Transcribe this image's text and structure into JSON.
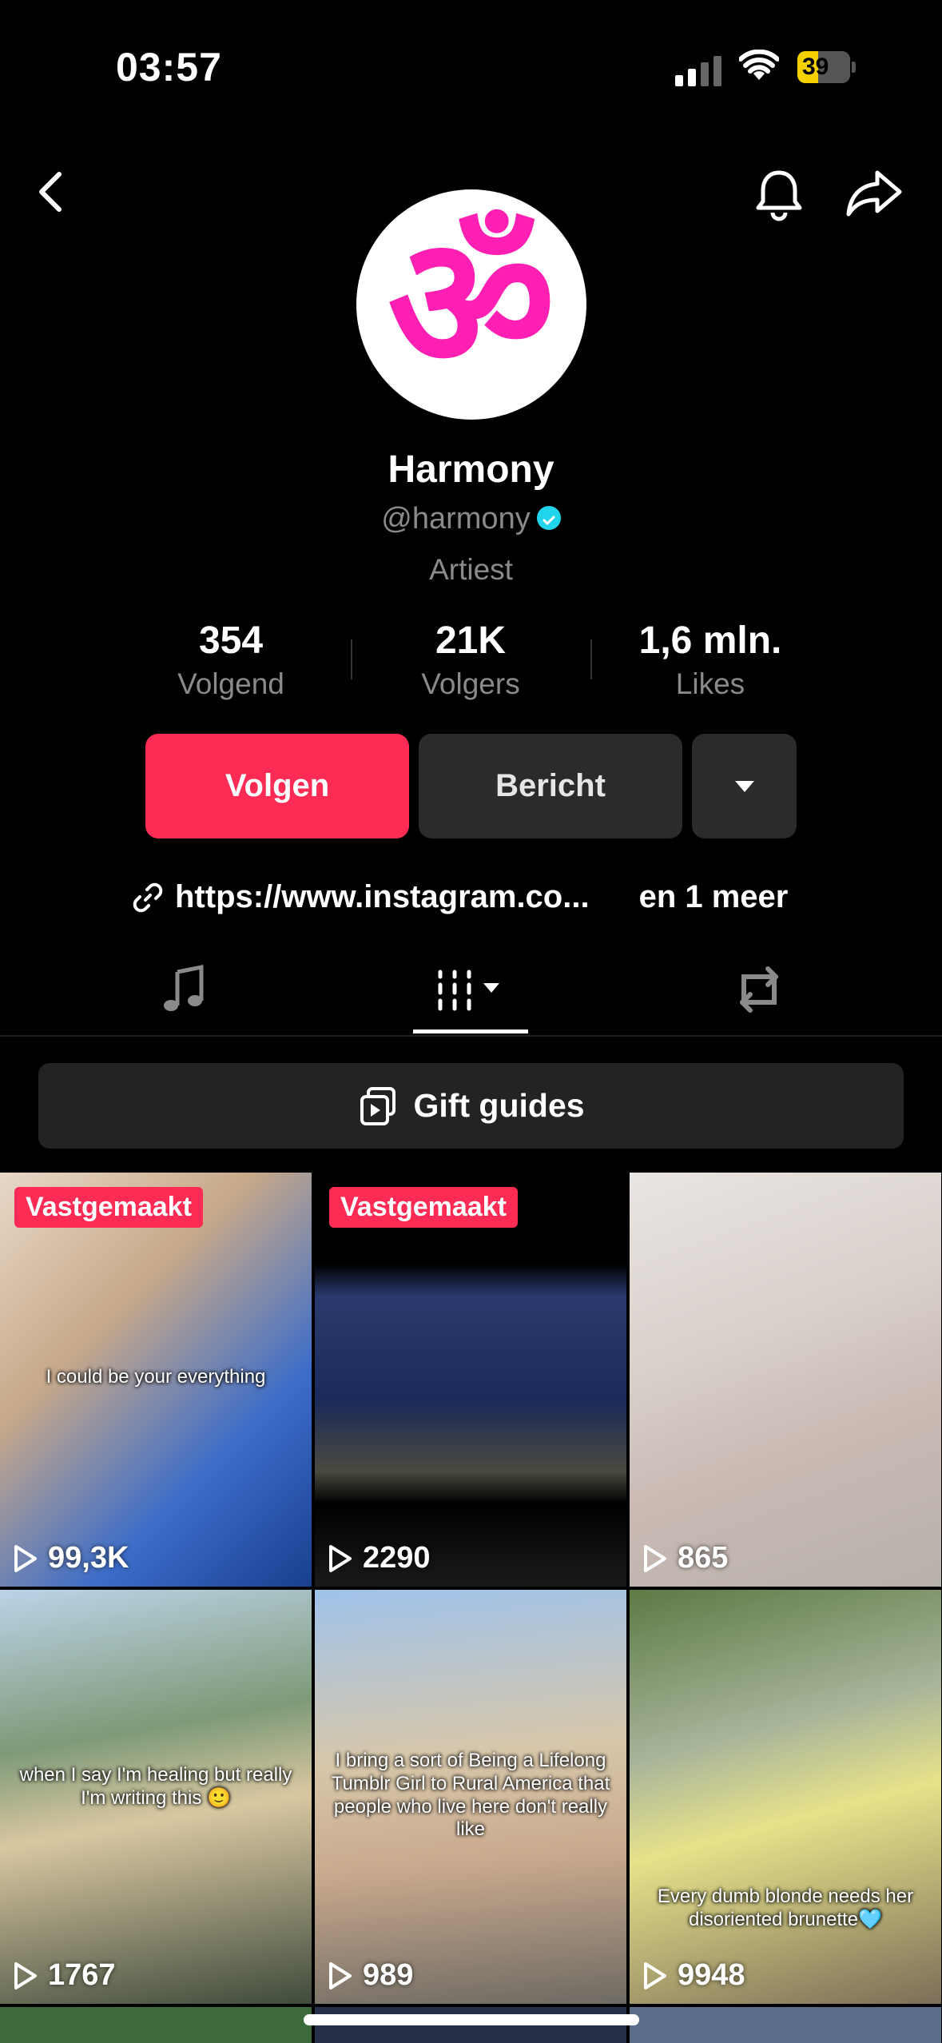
{
  "status_bar": {
    "time": "03:57",
    "battery": "39",
    "battery_level": 0.39
  },
  "profile": {
    "name": "Harmony",
    "handle": "@harmony",
    "category": "Artiest",
    "stats": [
      {
        "value": "354",
        "label": "Volgend"
      },
      {
        "value": "21K",
        "label": "Volgers"
      },
      {
        "value": "1,6 mln.",
        "label": "Likes"
      }
    ],
    "buttons": {
      "follow": "Volgen",
      "message": "Bericht"
    },
    "link": {
      "url": "https://www.instagram.co...",
      "extra": "en 1 meer"
    },
    "avatar_symbol": "ॐ",
    "accent_color": "#fe2c55",
    "avatar_color": "#ff1fb2"
  },
  "tabs": [
    "music-note-icon",
    "videos-grid-icon",
    "repost-icon"
  ],
  "gift_guides": {
    "label": "Gift guides"
  },
  "grid": [
    {
      "pinned": "Vastgemaakt",
      "views": "99,3K",
      "caption": "I could be your everything"
    },
    {
      "pinned": "Vastgemaakt",
      "views": "2290",
      "caption": ""
    },
    {
      "pinned": "",
      "views": "865",
      "caption": ""
    },
    {
      "pinned": "",
      "views": "1767",
      "caption": "when I say I'm healing but really I'm writing this 🙂"
    },
    {
      "pinned": "",
      "views": "989",
      "caption": "I bring a sort of Being a Lifelong Tumblr Girl to Rural America that people who live here don't really like"
    },
    {
      "pinned": "",
      "views": "9948",
      "caption": "Every dumb blonde needs her disoriented brunette🩵"
    }
  ]
}
